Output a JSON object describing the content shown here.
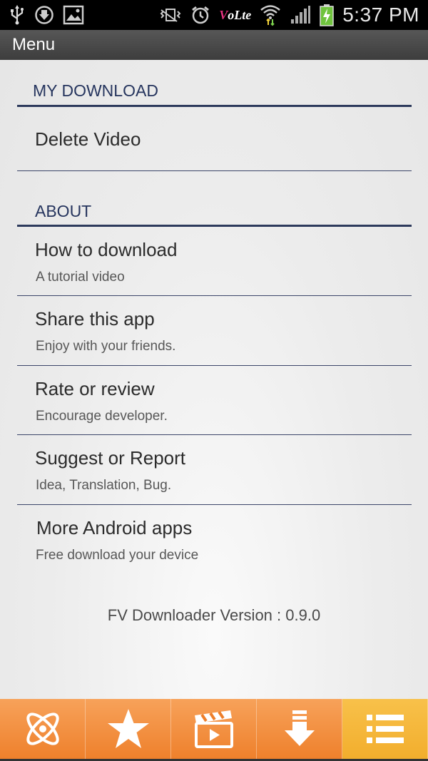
{
  "status_bar": {
    "time": "5:37 PM",
    "volte_v": "V",
    "volte_rest": "oLte",
    "icons_left": [
      "usb-icon",
      "download-notification-icon",
      "image-notification-icon"
    ],
    "icons_right": [
      "vibrate-icon",
      "alarm-icon",
      "volte-icon",
      "wifi-icon",
      "signal-icon",
      "battery-charging-icon"
    ]
  },
  "title_bar": {
    "title": "Menu"
  },
  "sections": {
    "my_download": {
      "header": "MY DOWNLOAD",
      "items": [
        {
          "title": "Delete Video"
        }
      ]
    },
    "about": {
      "header": "ABOUT",
      "items": [
        {
          "title": "How to download",
          "subtitle": "A tutorial video"
        },
        {
          "title": "Share this app",
          "subtitle": "Enjoy with your friends."
        },
        {
          "title": "Rate or review",
          "subtitle": "Encourage developer."
        },
        {
          "title": "Suggest or Report",
          "subtitle": "Idea, Translation, Bug."
        },
        {
          "title": "More Android apps",
          "subtitle": "Free download your device"
        }
      ]
    }
  },
  "version_text": "FV Downloader Version : 0.9.0",
  "tab_bar": {
    "tabs": [
      "atom-icon",
      "star-icon",
      "clapperboard-icon",
      "download-arrow-icon",
      "menu-list-icon"
    ],
    "active_index": 4,
    "colors": {
      "bar": "#ee7f2a",
      "active": "#f2ad2c"
    }
  },
  "colors": {
    "section_header_text": "#26355e",
    "divider": "#2d3a5c",
    "title_bar": "#4a4a4a"
  }
}
